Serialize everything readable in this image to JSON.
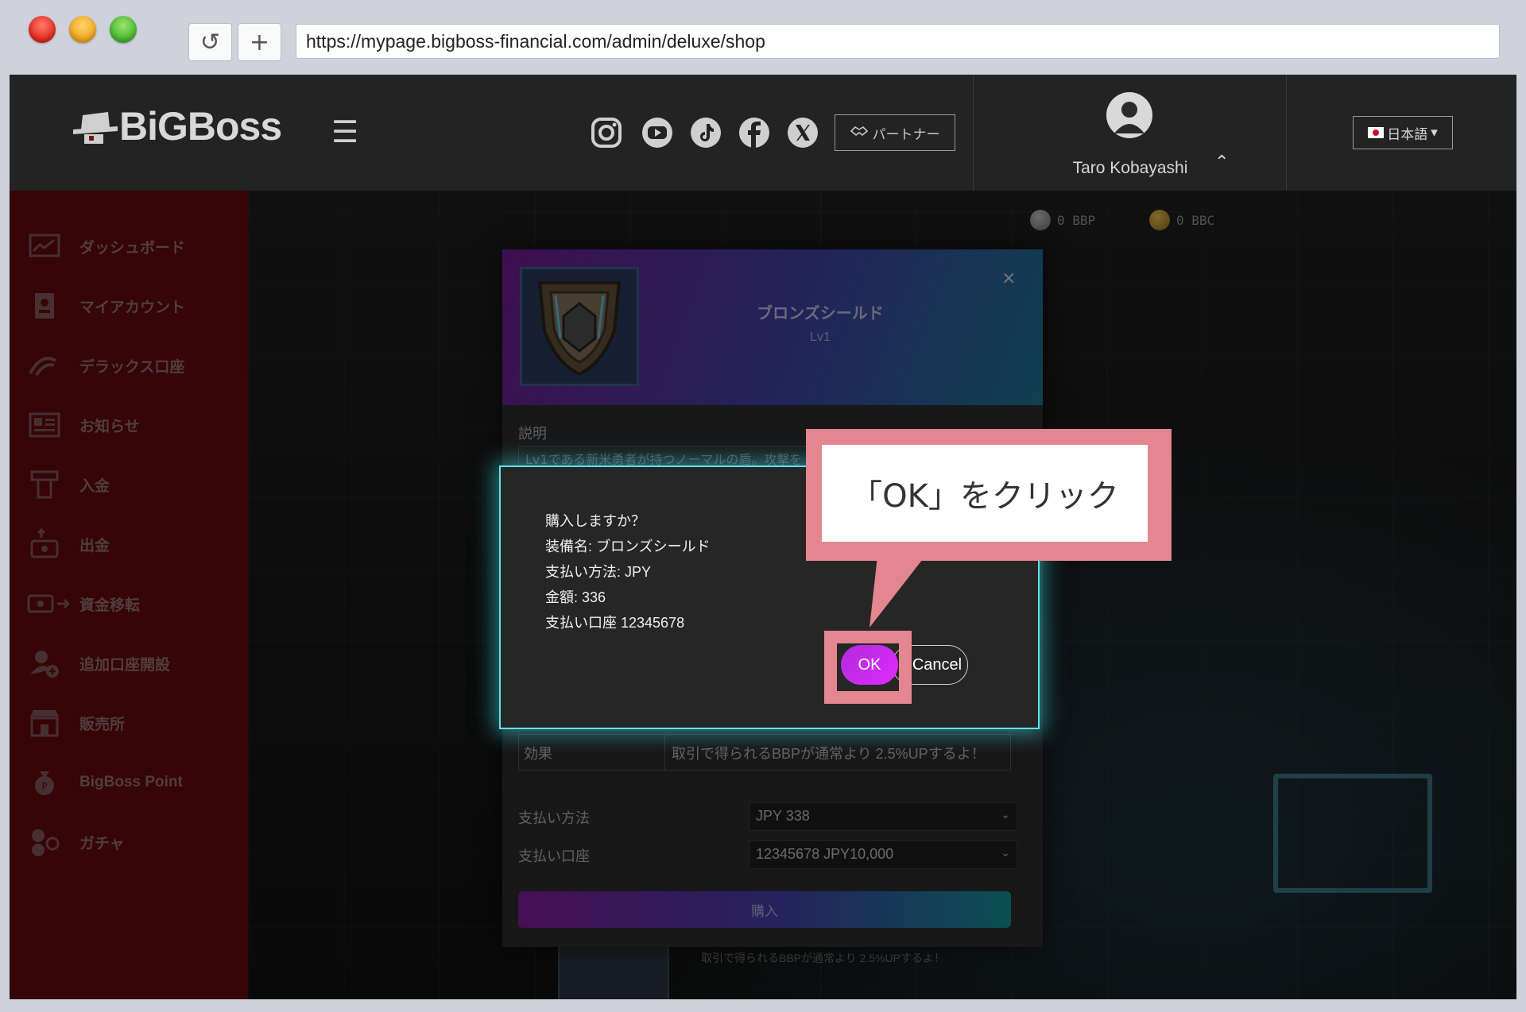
{
  "browser": {
    "url": "https://mypage.bigboss-financial.com/admin/deluxe/shop",
    "reload_glyph": "↺",
    "newtab_glyph": "+"
  },
  "header": {
    "logo_text": "BiGBoss",
    "hamburger_glyph": "☰",
    "social_icons": [
      "instagram-icon",
      "youtube-icon",
      "tiktok-icon",
      "facebook-icon",
      "x-icon"
    ],
    "partner_label": "パートナー",
    "username": "Taro Kobayashi",
    "caret_glyph": "⌃",
    "language_label": "日本語",
    "language_caret": "▾"
  },
  "sidebar": {
    "items": [
      {
        "label": "ダッシュボード",
        "icon": "dashboard-icon"
      },
      {
        "label": "マイアカウント",
        "icon": "account-icon"
      },
      {
        "label": "デラックス口座",
        "icon": "deluxe-icon"
      },
      {
        "label": "お知らせ",
        "icon": "news-icon"
      },
      {
        "label": "入金",
        "icon": "deposit-icon"
      },
      {
        "label": "出金",
        "icon": "withdraw-icon"
      },
      {
        "label": "資金移転",
        "icon": "transfer-icon"
      },
      {
        "label": "追加口座開設",
        "icon": "add-account-icon"
      },
      {
        "label": "販売所",
        "icon": "store-icon"
      },
      {
        "label": "BigBoss Point",
        "icon": "point-icon"
      },
      {
        "label": "ガチャ",
        "icon": "gacha-icon"
      }
    ]
  },
  "balances": {
    "bbp": "0 BBP",
    "bbc": "0 BBC"
  },
  "shop_modal": {
    "item_name": "ブロンズシールド",
    "item_level": "Lv1",
    "close_glyph": "×",
    "description_label": "説明",
    "description_text": "Lv1である新米勇者が持つノーマルの盾。攻撃を",
    "effect_key": "効果",
    "effect_value": "取引で得られるBBPが通常より 2.5%UPするよ！",
    "payment_method_label": "支払い方法",
    "payment_method_value": "JPY 338",
    "payment_account_label": "支払い口座",
    "payment_account_value": "12345678 JPY10,000",
    "select_caret": "⌄",
    "buy_label": "購入"
  },
  "background_caption": "取引で得られるBBPが通常より 2.5%UPするよ！",
  "confirm_dialog": {
    "lines": [
      "購入しますか？",
      "装備名: ブロンズシールド",
      "支払い方法: JPY",
      "金額: 336",
      "支払い口座 12345678"
    ],
    "ok_label": "OK",
    "cancel_label": "Cancel"
  },
  "callout": {
    "text": "「OK」をクリック",
    "color": "#e48690"
  },
  "colors": {
    "sidebar_bg": "#5c0a0d",
    "header_bg": "#232323",
    "dialog_glow": "#5fe3ea",
    "ok_button": "#c92bef"
  }
}
